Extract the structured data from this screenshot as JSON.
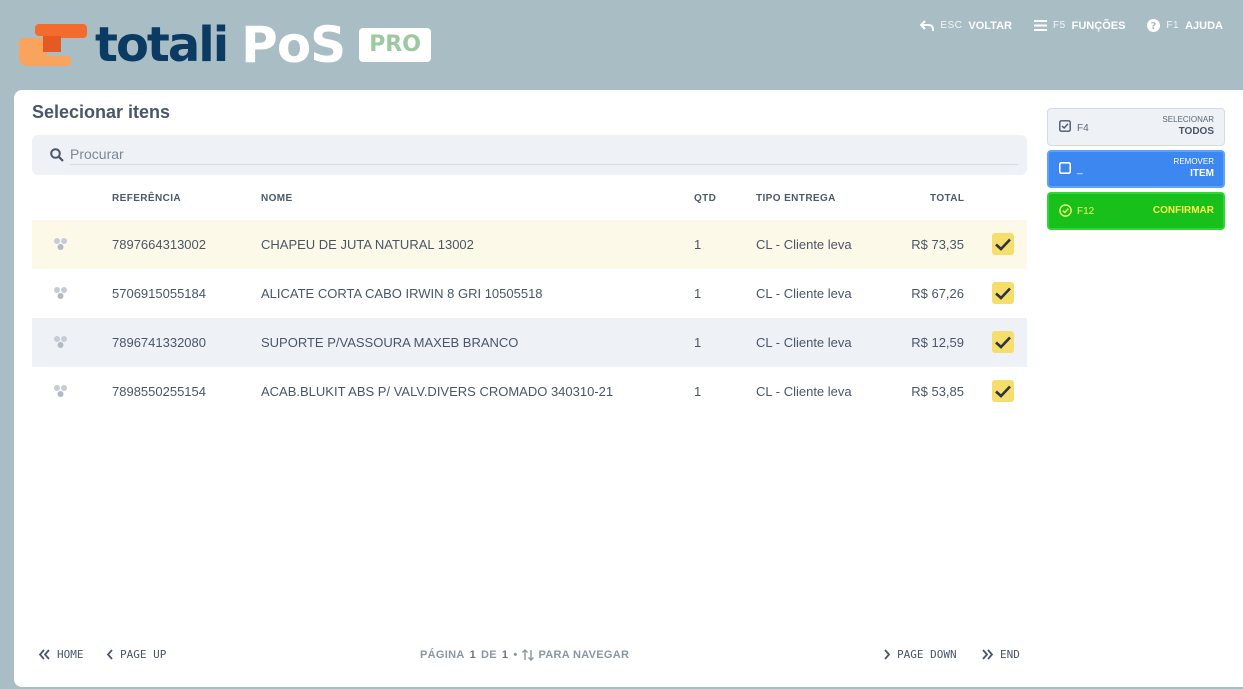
{
  "brand": {
    "word": "totali",
    "product": "PoS",
    "edition": "PRO",
    "colors": {
      "mark_orange": "#f36c2e",
      "mark_light": "#f9a45c",
      "word": "#0b3a63",
      "pro_text": "#9cc9a0"
    }
  },
  "top_actions": [
    {
      "key": "ESC",
      "label": "VOLTAR",
      "icon": "undo-arrow-icon"
    },
    {
      "key": "F5",
      "label": "FUNÇÕES",
      "icon": "menu-icon"
    },
    {
      "key": "F1",
      "label": "AJUDA",
      "icon": "help-icon"
    }
  ],
  "page": {
    "title": "Selecionar itens",
    "search_placeholder": "Procurar"
  },
  "table": {
    "columns": [
      "REFERÊNCIA",
      "NOME",
      "QTD",
      "TIPO ENTREGA",
      "TOTAL"
    ],
    "rows": [
      {
        "ref": "7897664313002",
        "name": "CHAPEU DE JUTA NATURAL 13002",
        "qty": "1",
        "delivery": "CL - Cliente leva",
        "total": "R$ 73,35",
        "selected": true
      },
      {
        "ref": "5706915055184",
        "name": "ALICATE CORTA CABO IRWIN 8 GRI 10505518",
        "qty": "1",
        "delivery": "CL - Cliente leva",
        "total": "R$ 67,26",
        "selected": true
      },
      {
        "ref": "7896741332080",
        "name": "SUPORTE P/VASSOURA MAXEB BRANCO",
        "qty": "1",
        "delivery": "CL - Cliente leva",
        "total": "R$ 12,59",
        "selected": true
      },
      {
        "ref": "7898550255154",
        "name": "ACAB.BLUKIT ABS P/ VALV.DIVERS CROMADO 340310-21",
        "qty": "1",
        "delivery": "CL - Cliente leva",
        "total": "R$ 53,85",
        "selected": true
      }
    ]
  },
  "footer": {
    "home": "HOME",
    "page_up": "PAGE UP",
    "page_label": "PÁGINA",
    "page_current": "1",
    "page_of": "DE",
    "page_total": "1",
    "separator": "•",
    "navigate": "PARA NAVEGAR",
    "page_down": "PAGE DOWN",
    "end": "END"
  },
  "side_buttons": {
    "select_all": {
      "key": "F4",
      "small": "SELECIONAR",
      "big": "TODOS"
    },
    "remove": {
      "key": "_",
      "small": "REMOVER",
      "big": "ITEM"
    },
    "confirm": {
      "key": "F12",
      "label": "CONFIRMAR"
    }
  },
  "colors": {
    "header_bg": "#a9bdc5",
    "highlight_row": "#fcf9e8",
    "check_bg": "#f5de6c",
    "blue_button": "#3d87f0",
    "green_button": "#18c01c",
    "confirm_text": "#fff04a"
  }
}
